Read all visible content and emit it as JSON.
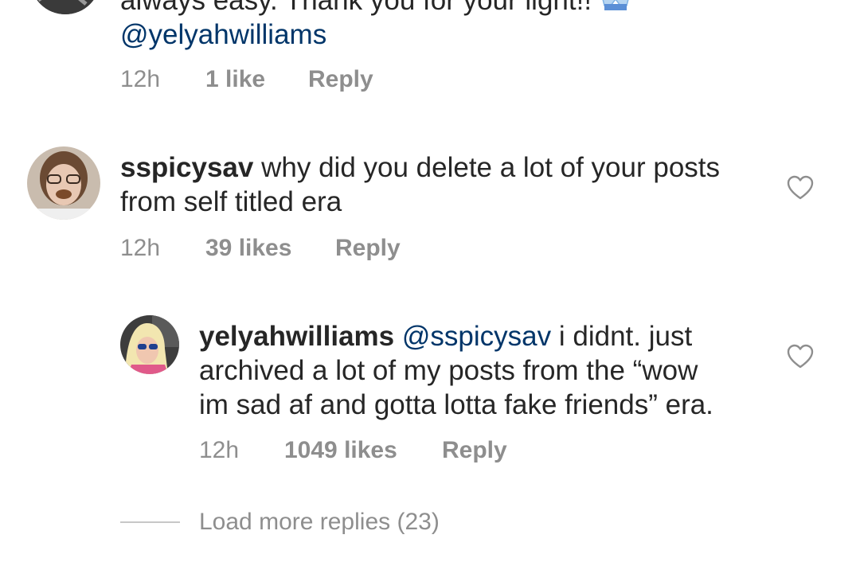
{
  "comments": [
    {
      "text_line1": "always easy. Thank you for your light!!",
      "mention": "@yelyahwilliams",
      "time": "12h",
      "likes": "1 like",
      "reply_label": "Reply"
    },
    {
      "username": "sspicysav",
      "text_line1": "why did you delete a lot of your posts",
      "text_line2": "from self titled era",
      "time": "12h",
      "likes": "39 likes",
      "reply_label": "Reply"
    }
  ],
  "reply": {
    "username": "yelyahwilliams",
    "mention": "@sspicysav",
    "text_line1_rest": "i didnt. just",
    "text_line2": "archived a lot of my posts from the “wow",
    "text_line3": "im sad af and gotta lotta fake friends” era.",
    "time": "12h",
    "likes": "1049 likes",
    "reply_label": "Reply"
  },
  "load_more": "Load more replies (23)",
  "colors": {
    "text": "#262626",
    "meta": "#8e8e8e",
    "mention": "#003569"
  },
  "icons": {
    "like": "heart-outline-icon",
    "emoji": "raised-hands-emoji"
  }
}
